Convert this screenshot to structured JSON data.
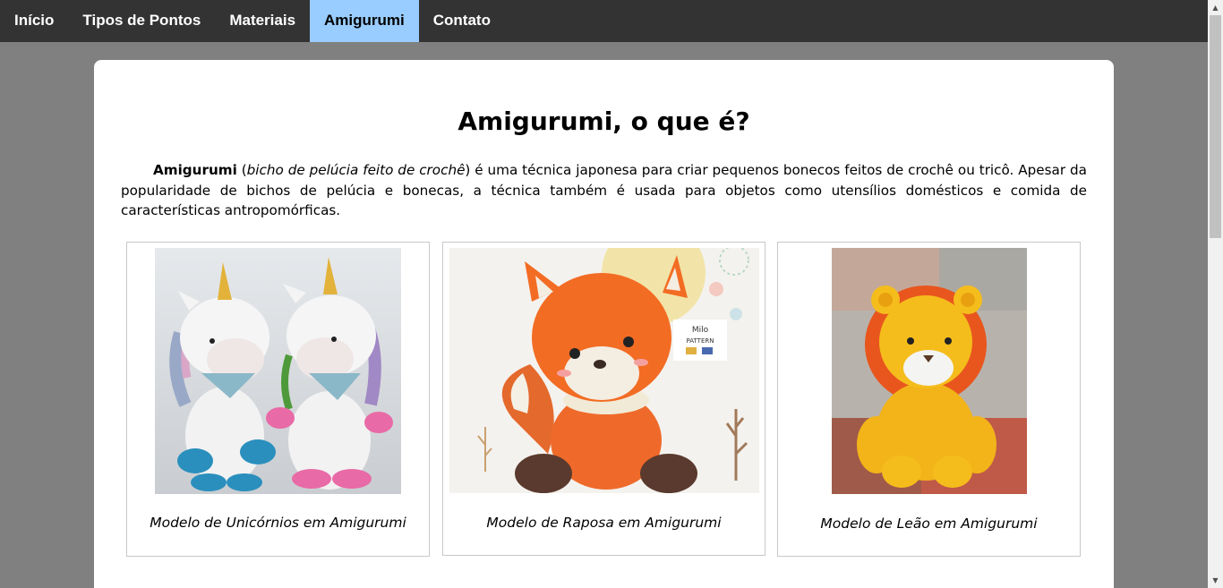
{
  "nav": {
    "items": [
      {
        "label": "Início",
        "active": false
      },
      {
        "label": "Tipos de Pontos",
        "active": false
      },
      {
        "label": "Materiais",
        "active": false
      },
      {
        "label": "Amigurumi",
        "active": true
      },
      {
        "label": "Contato",
        "active": false
      }
    ]
  },
  "page": {
    "title": "Amigurumi, o que é?",
    "intro_bold": "Amigurumi",
    "intro_paren_open": " (",
    "intro_italic": "bicho de pelúcia feito de crochê",
    "intro_rest": ") é uma técnica japonesa para criar pequenos bonecos feitos de crochê ou tricô. Apesar da popularidade de bichos de pelúcia e bonecas, a técnica também é usada para objetos como utensílios domésticos e comida de características antropomórficas."
  },
  "gallery": [
    {
      "caption": "Modelo de Unicórnios em Amigurumi",
      "image": "unicorns-photo"
    },
    {
      "caption": "Modelo de Raposa em Amigurumi",
      "image": "fox-photo"
    },
    {
      "caption": "Modelo de Leão em Amigurumi",
      "image": "lion-photo"
    }
  ],
  "colors": {
    "nav_bg": "#333333",
    "nav_active": "#99ccff",
    "page_bg": "#808080",
    "card_bg": "#ffffff"
  }
}
